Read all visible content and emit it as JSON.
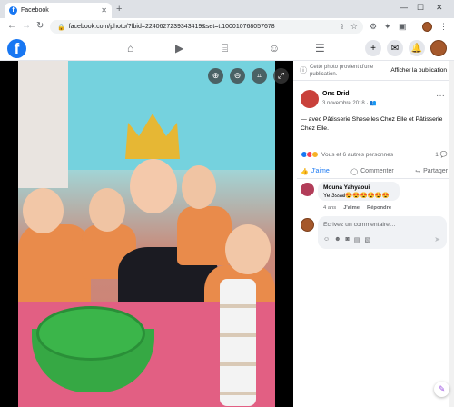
{
  "browser": {
    "tab_title": "Facebook",
    "url": "facebook.com/photo/?fbid=2240627239343419&set=t.100010768057678"
  },
  "panel": {
    "notice": "Cette photo provient d'une publication.",
    "notice_button": "Afficher la publication",
    "author": "Ons Dridi",
    "date": "3 novembre 2018 · 👥",
    "caption": "— avec Pâtisserie Sheselles Chez Elle et Pâtisserie Chez Elle.",
    "reactions": "Vous et 6 autres personnes",
    "comment_count": "1",
    "actions": {
      "like": "J'aime",
      "comment": "Commenter",
      "share": "Partager"
    },
    "comment": {
      "author": "Mouna Yahyaoui",
      "text": "Ye 3ssal😍😍😍😍😍😍",
      "age": "4 ans",
      "like": "J'aime",
      "reply": "Répondre"
    },
    "input_placeholder": "Écrivez un commentaire…"
  },
  "colors": {
    "facebook_blue": "#1877f2",
    "panel_bg": "#ffffff",
    "input_bg": "#f0f2f5"
  },
  "icons": {
    "fb_nav": [
      "home-icon",
      "watch-icon",
      "marketplace-icon",
      "groups-icon",
      "menu-icon"
    ],
    "fb_right": [
      "plus-icon",
      "messenger-icon",
      "notifications-icon",
      "profile-avatar"
    ],
    "photo_controls": [
      "zoom-in-icon",
      "zoom-out-icon",
      "tag-icon",
      "fullscreen-icon"
    ]
  }
}
